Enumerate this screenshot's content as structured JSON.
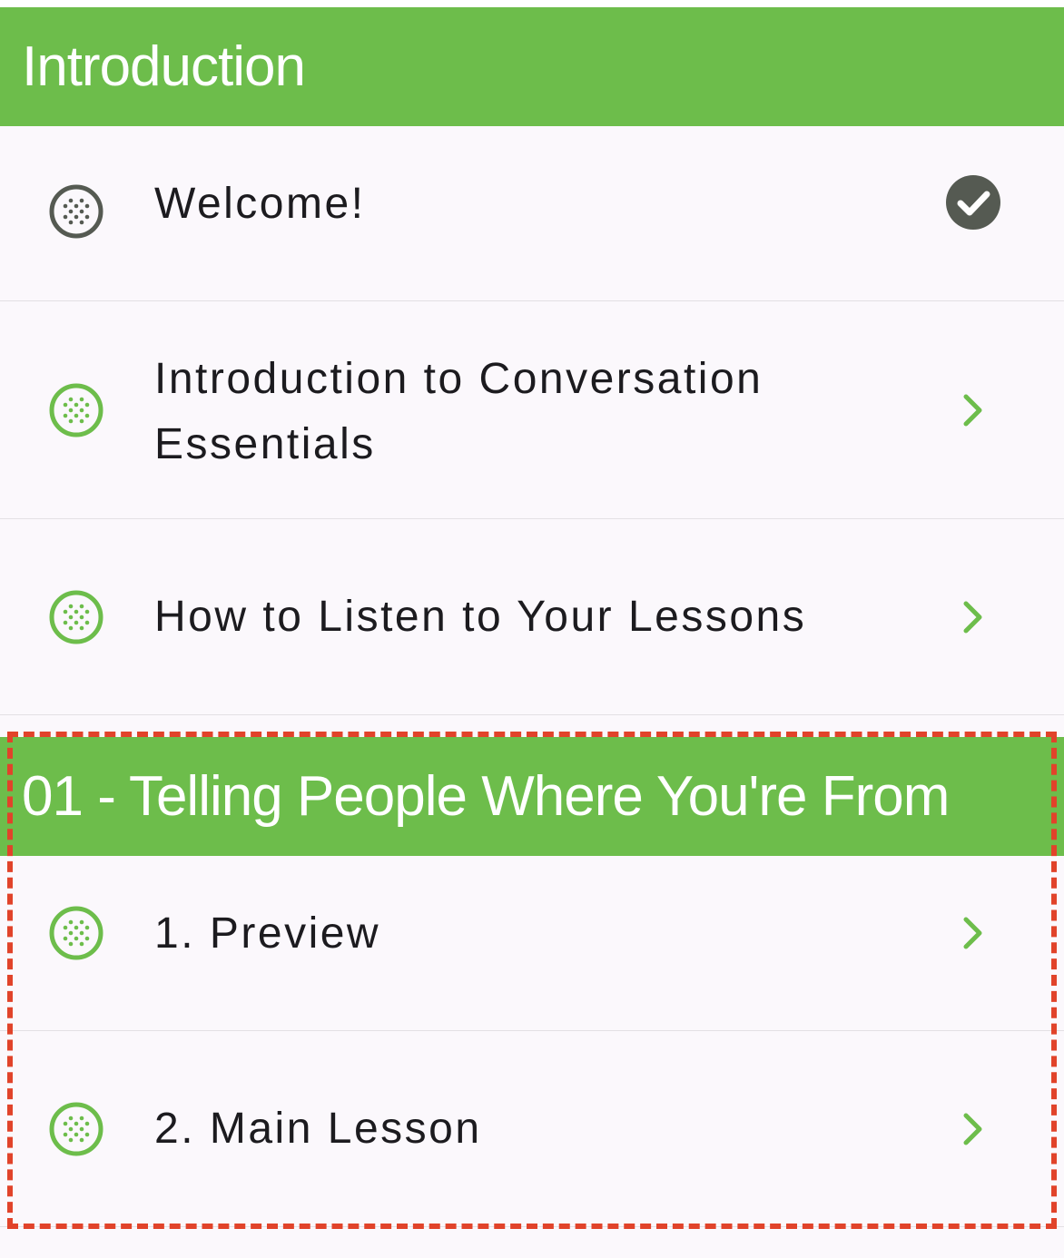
{
  "sections": [
    {
      "title": "Introduction",
      "lessons": [
        {
          "label": "Welcome!",
          "status": "completed"
        },
        {
          "label": "Introduction to Conversation Essentials",
          "status": "open"
        },
        {
          "label": "How to Listen to Your Lessons",
          "status": "open"
        }
      ]
    },
    {
      "title": "01 - Telling People Where You're From",
      "lessons": [
        {
          "label": "1. Preview",
          "status": "open"
        },
        {
          "label": "2. Main Lesson",
          "status": "open"
        }
      ]
    }
  ],
  "colors": {
    "header_green": "#6dbd4b",
    "completed_icon": "#555a52",
    "lesson_icon_green": "#6dbd4b",
    "highlight_dash": "#e1432a"
  },
  "icons": {
    "lesson": "dotted-circle-icon",
    "completed": "check-circle-icon",
    "open": "chevron-right-icon"
  }
}
